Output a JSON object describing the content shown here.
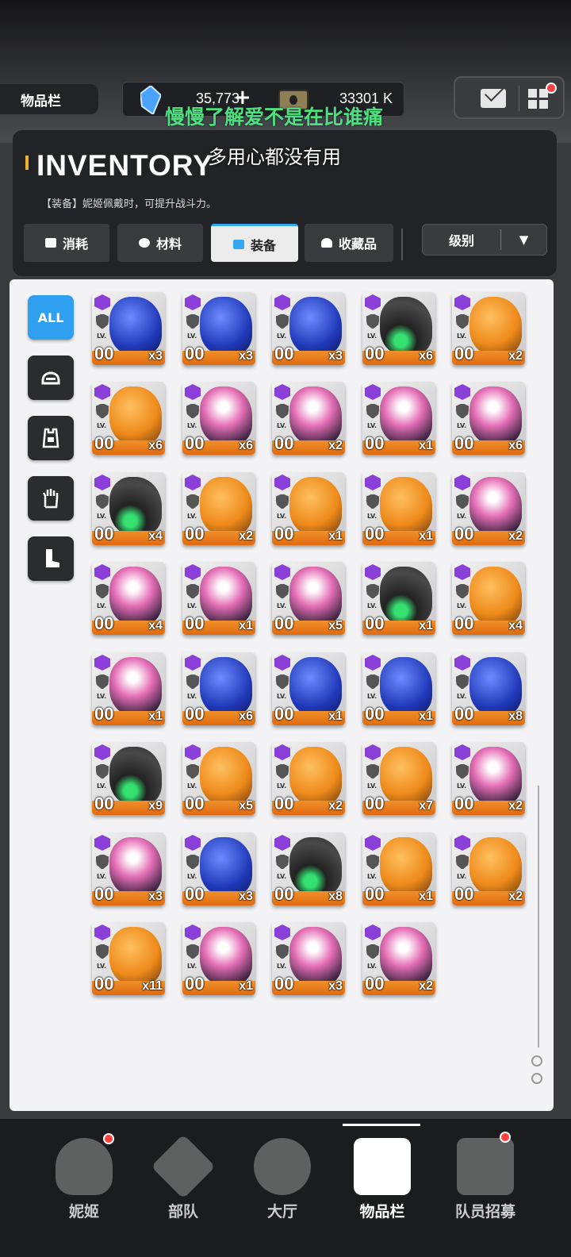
{
  "topbar": {
    "title": "物品栏",
    "crystal_count": "35,773",
    "plus_label": "+",
    "cash_count": "33301 K"
  },
  "overlay": {
    "lyric_line1": "慢慢了解爱不是在比谁痛",
    "lyric_line2": "多用心都没有用"
  },
  "panel": {
    "title": "INVENTORY",
    "description": "【装备】妮姬佩戴时，可提升战斗力。"
  },
  "tabs": [
    {
      "label": "消耗",
      "icon": "consumable-icon"
    },
    {
      "label": "材料",
      "icon": "material-icon"
    },
    {
      "label": "装备",
      "icon": "equipment-icon",
      "active": true
    },
    {
      "label": "收藏品",
      "icon": "collection-icon"
    }
  ],
  "sort": {
    "label": "级别",
    "arrow": "▼"
  },
  "filters": [
    {
      "label": "ALL",
      "active": true
    },
    {
      "label": "",
      "icon": "helmet-icon"
    },
    {
      "label": "",
      "icon": "armor-icon"
    },
    {
      "label": "",
      "icon": "glove-icon"
    },
    {
      "label": "",
      "icon": "boot-icon"
    }
  ],
  "items": [
    {
      "level": "00",
      "qty": "x3",
      "color": "blue"
    },
    {
      "level": "00",
      "qty": "x3",
      "color": "blue"
    },
    {
      "level": "00",
      "qty": "x3",
      "color": "blue"
    },
    {
      "level": "00",
      "qty": "x6",
      "color": "black"
    },
    {
      "level": "00",
      "qty": "x2",
      "color": "orange"
    },
    {
      "level": "00",
      "qty": "x6",
      "color": "orange"
    },
    {
      "level": "00",
      "qty": "x6",
      "color": "pink"
    },
    {
      "level": "00",
      "qty": "x2",
      "color": "pink"
    },
    {
      "level": "00",
      "qty": "x1",
      "color": "pink"
    },
    {
      "level": "00",
      "qty": "x6",
      "color": "pink"
    },
    {
      "level": "00",
      "qty": "x4",
      "color": "black"
    },
    {
      "level": "00",
      "qty": "x2",
      "color": "orange"
    },
    {
      "level": "00",
      "qty": "x1",
      "color": "orange"
    },
    {
      "level": "00",
      "qty": "x1",
      "color": "orange"
    },
    {
      "level": "00",
      "qty": "x2",
      "color": "pink"
    },
    {
      "level": "00",
      "qty": "x4",
      "color": "pink"
    },
    {
      "level": "00",
      "qty": "x1",
      "color": "pink"
    },
    {
      "level": "00",
      "qty": "x5",
      "color": "pink"
    },
    {
      "level": "00",
      "qty": "x1",
      "color": "black"
    },
    {
      "level": "00",
      "qty": "x4",
      "color": "orange"
    },
    {
      "level": "00",
      "qty": "x1",
      "color": "pink"
    },
    {
      "level": "00",
      "qty": "x6",
      "color": "blue"
    },
    {
      "level": "00",
      "qty": "x1",
      "color": "blue"
    },
    {
      "level": "00",
      "qty": "x1",
      "color": "blue"
    },
    {
      "level": "00",
      "qty": "x8",
      "color": "blue"
    },
    {
      "level": "00",
      "qty": "x9",
      "color": "black"
    },
    {
      "level": "00",
      "qty": "x5",
      "color": "orange"
    },
    {
      "level": "00",
      "qty": "x2",
      "color": "orange"
    },
    {
      "level": "00",
      "qty": "x7",
      "color": "orange"
    },
    {
      "level": "00",
      "qty": "x2",
      "color": "pink"
    },
    {
      "level": "00",
      "qty": "x3",
      "color": "pink"
    },
    {
      "level": "00",
      "qty": "x3",
      "color": "blue"
    },
    {
      "level": "00",
      "qty": "x8",
      "color": "black"
    },
    {
      "level": "00",
      "qty": "x1",
      "color": "orange"
    },
    {
      "level": "00",
      "qty": "x2",
      "color": "orange"
    },
    {
      "level": "00",
      "qty": "x11",
      "color": "orange"
    },
    {
      "level": "00",
      "qty": "x1",
      "color": "pink"
    },
    {
      "level": "00",
      "qty": "x3",
      "color": "pink"
    },
    {
      "level": "00",
      "qty": "x2",
      "color": "pink"
    }
  ],
  "item_level_label": "LV.",
  "nav": [
    {
      "label": "妮姬",
      "icon": "nikke-icon",
      "badge": true
    },
    {
      "label": "部队",
      "icon": "squad-icon",
      "badge": false
    },
    {
      "label": "大厅",
      "icon": "lobby-icon",
      "badge": false
    },
    {
      "label": "物品栏",
      "icon": "inventory-icon",
      "badge": false,
      "active": true
    },
    {
      "label": "队员招募",
      "icon": "recruit-icon",
      "badge": true
    }
  ]
}
